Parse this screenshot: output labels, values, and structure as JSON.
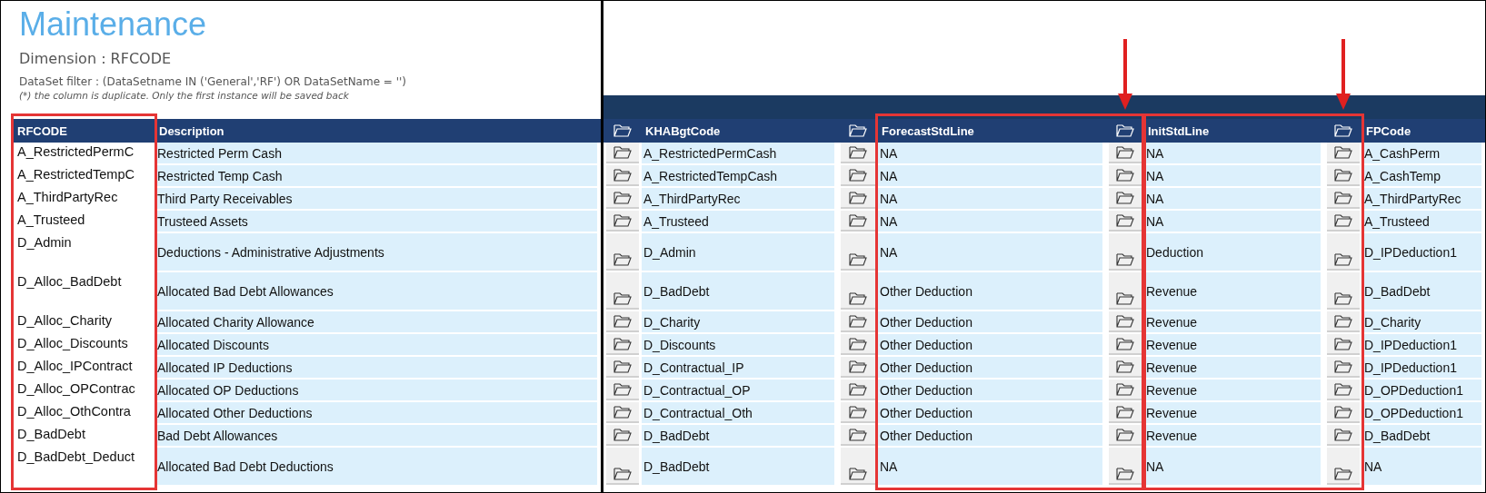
{
  "title": "Maintenance",
  "dimension": "Dimension : RFCODE",
  "filter": "DataSet filter : (DataSetname IN ('General','RF') OR DataSetName = '')",
  "note": "(*) the column is duplicate. Only the first instance will be saved back",
  "columns": [
    {
      "label": "RFCODE",
      "kind": "key",
      "has_picker": false,
      "highlighted": true,
      "arrow": false
    },
    {
      "label": "Description",
      "kind": "text",
      "has_picker": false,
      "highlighted": false,
      "arrow": false
    },
    {
      "label": "KHABgtCode",
      "kind": "text",
      "has_picker": true,
      "highlighted": false,
      "arrow": false
    },
    {
      "label": "ForecastStdLine",
      "kind": "text",
      "has_picker": true,
      "highlighted": true,
      "arrow": true
    },
    {
      "label": "InitStdLine",
      "kind": "text",
      "has_picker": true,
      "highlighted": true,
      "arrow": true
    },
    {
      "label": "FPCode",
      "kind": "text",
      "has_picker": true,
      "highlighted": false,
      "arrow": false
    }
  ],
  "rows": [
    {
      "kind": "normal",
      "cells": [
        "A_RestrictedPermC",
        "Restricted Perm Cash",
        "A_RestrictedPermCash",
        "NA",
        "NA",
        "A_CashPerm"
      ]
    },
    {
      "kind": "normal",
      "cells": [
        "A_RestrictedTempC",
        "Restricted Temp Cash",
        "A_RestrictedTempCash",
        "NA",
        "NA",
        "A_CashTemp"
      ]
    },
    {
      "kind": "normal",
      "cells": [
        "A_ThirdPartyRec",
        "Third Party Receivables",
        "A_ThirdPartyRec",
        "NA",
        "NA",
        "A_ThirdPartyRec"
      ]
    },
    {
      "kind": "normal",
      "cells": [
        "A_Trusteed",
        "Trusteed Assets",
        "A_Trusteed",
        "NA",
        "NA",
        "A_Trusteed"
      ]
    },
    {
      "kind": "tall",
      "cells": [
        "D_Admin",
        "Deductions - Administrative Adjustments",
        "D_Admin",
        "NA",
        "Deduction",
        "D_IPDeduction1"
      ]
    },
    {
      "kind": "tall",
      "cells": [
        "D_Alloc_BadDebt",
        "Allocated Bad Debt Allowances",
        "D_BadDebt",
        "Other Deduction",
        "Revenue",
        "D_BadDebt"
      ]
    },
    {
      "kind": "normal",
      "cells": [
        "D_Alloc_Charity",
        "Allocated Charity Allowance",
        "D_Charity",
        "Other Deduction",
        "Revenue",
        "D_Charity"
      ]
    },
    {
      "kind": "normal",
      "cells": [
        "D_Alloc_Discounts",
        "Allocated Discounts",
        "D_Discounts",
        "Other Deduction",
        "Revenue",
        "D_IPDeduction1"
      ]
    },
    {
      "kind": "normal",
      "cells": [
        "D_Alloc_IPContract",
        "Allocated IP Deductions",
        "D_Contractual_IP",
        "Other Deduction",
        "Revenue",
        "D_IPDeduction1"
      ]
    },
    {
      "kind": "normal",
      "cells": [
        "D_Alloc_OPContrac",
        "Allocated OP Deductions",
        "D_Contractual_OP",
        "Other Deduction",
        "Revenue",
        "D_OPDeduction1"
      ]
    },
    {
      "kind": "normal",
      "cells": [
        "D_Alloc_OthContra",
        "Allocated Other Deductions",
        "D_Contractual_Oth",
        "Other Deduction",
        "Revenue",
        "D_OPDeduction1"
      ]
    },
    {
      "kind": "normal",
      "cells": [
        "D_BadDebt",
        "Bad Debt Allowances",
        "D_BadDebt",
        "Other Deduction",
        "Revenue",
        "D_BadDebt"
      ]
    },
    {
      "kind": "tall",
      "cells": [
        "D_BadDebt_Deduct",
        "Allocated Bad Debt Deductions",
        "D_BadDebt",
        "NA",
        "NA",
        "NA"
      ]
    }
  ]
}
